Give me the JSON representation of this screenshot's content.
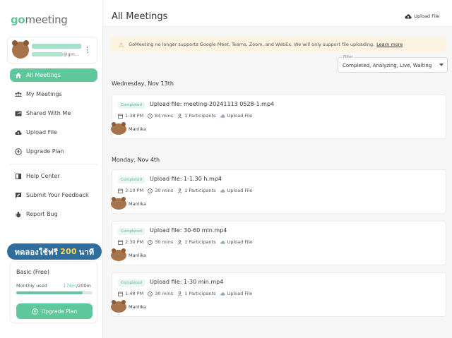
{
  "sidebar": {
    "logo_go": "go",
    "logo_rest": "meeting",
    "user": {
      "email_suffix": "@gm..."
    },
    "nav": [
      {
        "label": "All Meetings",
        "icon": "home-icon"
      },
      {
        "label": "My Meetings",
        "icon": "users-icon"
      },
      {
        "label": "Shared With Me",
        "icon": "share-icon"
      },
      {
        "label": "Upload File",
        "icon": "cloud-upload-icon"
      },
      {
        "label": "Upgrade Plan",
        "icon": "arrow-up-circle-icon"
      }
    ],
    "nav2": [
      {
        "label": "Help Center",
        "icon": "book-icon"
      },
      {
        "label": "Submit Your Feedback",
        "icon": "feedback-icon"
      },
      {
        "label": "Report Bug",
        "icon": "bug-icon"
      }
    ],
    "promo": {
      "prefix": "ทดลองใช้ฟรี",
      "number": "200",
      "suffix": "นาที"
    },
    "plan": {
      "title": "Basic (Free)",
      "used_label": "Monthly used",
      "used_value": "174m",
      "total_value": "/200m",
      "used_fraction": 0.87,
      "button_label": "Upgrade Plan"
    }
  },
  "header": {
    "title": "All Meetings",
    "upload_label": "Upload File"
  },
  "banner": {
    "text": "GoMeeting no longer supports Google Meet, Teams, Zoom, and WebEx. We will only support file uploading.",
    "link": "Learn more"
  },
  "filter": {
    "label": "Filter",
    "value": "Completed, Analyzing, Live, Waiting"
  },
  "groups": [
    {
      "date": "Wednesday, Nov 13th",
      "meetings": [
        {
          "status": "Completed",
          "title": "Upload file: meeting-20241113 0528-1.mp4",
          "time": "1:38 PM",
          "duration": "84 mins",
          "participants": "1 Participants",
          "source": "Upload File",
          "owner": "Manlika"
        }
      ]
    },
    {
      "date": "Monday, Nov 4th",
      "meetings": [
        {
          "status": "Completed",
          "title": "Upload file: 1-1.30 h.mp4",
          "time": "3:10 PM",
          "duration": "30 mins",
          "participants": "1 Participants",
          "source": "Upload File",
          "owner": "Manlika"
        },
        {
          "status": "Completed",
          "title": "Upload file: 30-60 min.mp4",
          "time": "2:30 PM",
          "duration": "30 mins",
          "participants": "1 Participants",
          "source": "Upload File",
          "owner": "Manlika"
        },
        {
          "status": "Completed",
          "title": "Upload file: 1-30 min.mp4",
          "time": "1:48 PM",
          "duration": "30 mins",
          "participants": "1 Participants",
          "source": "Upload File",
          "owner": "Manlika"
        }
      ]
    }
  ],
  "colors": {
    "accent": "#5fc79c",
    "promo": "#2f6d9c",
    "banner_bg": "#fdf3e2"
  }
}
